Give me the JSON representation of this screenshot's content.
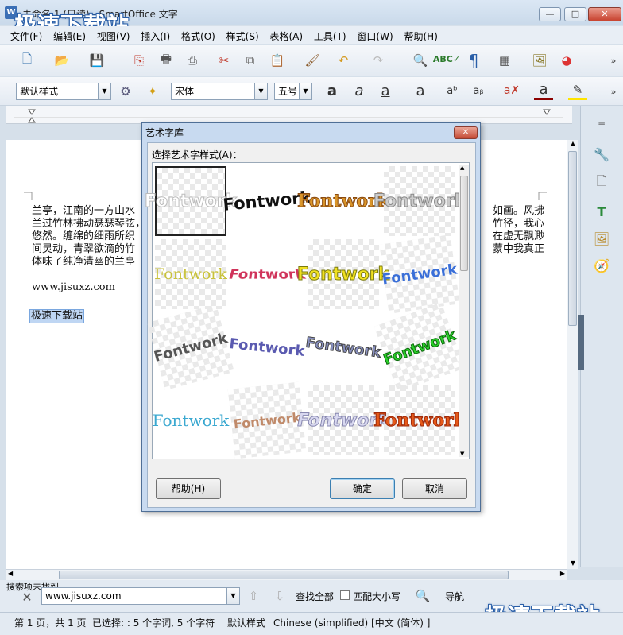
{
  "window": {
    "app_icon": "W",
    "title": "未命名 1 (只读) - SmartOffice 文字",
    "min": "—",
    "max": "□",
    "close": "✕",
    "watermark": "极速下载站"
  },
  "menu": [
    "文件(F)",
    "编辑(E)",
    "视图(V)",
    "插入(I)",
    "格式(O)",
    "样式(S)",
    "表格(A)",
    "工具(T)",
    "窗口(W)",
    "帮助(H)"
  ],
  "format_bar": {
    "style": "默认样式",
    "font": "宋体",
    "size": "五号"
  },
  "document": {
    "para_left": [
      "兰亭，江南的一方山水",
      "兰过竹林拂动瑟瑟琴弦，",
      "悠然。缠绵的细雨所织",
      "间灵动，青翠欲滴的竹",
      "体味了纯净清幽的兰亭"
    ],
    "para_right": [
      "如画。风拂",
      "竹径，我心",
      "在虚无飘渺",
      "蒙中我真正",
      ""
    ],
    "url": "www.jisuxz.com",
    "selected": "极速下载站"
  },
  "find_bar": {
    "label": "搜索项未找到",
    "value": "www.jisuxz.com",
    "find_all": "查找全部",
    "match_case": "匹配大小写",
    "nav": "导航"
  },
  "status": {
    "page": "第 1 页，共 1 页",
    "selection": "已选择: : 5 个字词, 5 个字符",
    "style": "默认样式",
    "language": "Chinese (simplified) [中文 (简体) ]"
  },
  "dialog": {
    "title": "艺术字库",
    "label": "选择艺术字样式(A)：",
    "sample": "Fontwork",
    "help": "帮助(H)",
    "ok": "确定",
    "cancel": "取消",
    "close": "✕"
  },
  "colors": {
    "accent": "#3b6fb5",
    "selection": "#bfd6f3"
  }
}
